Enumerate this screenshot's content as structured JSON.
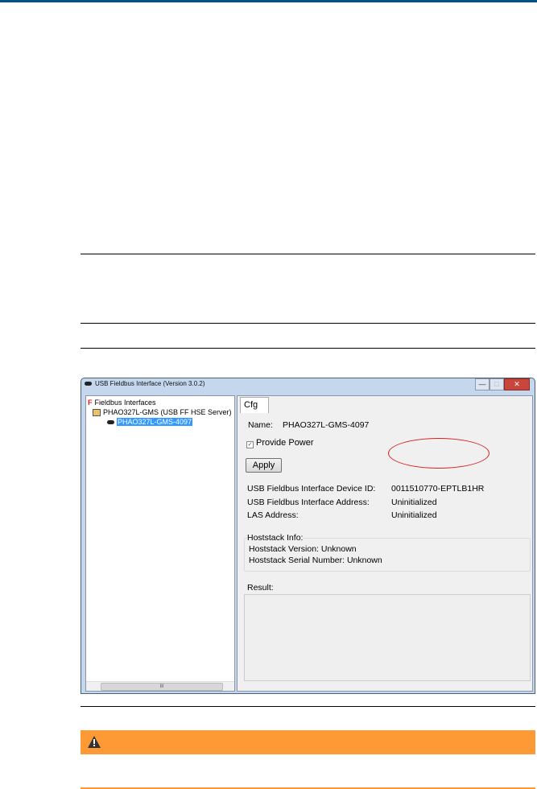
{
  "window": {
    "title": "USB Fieldbus Interface (Version 3.0.2)",
    "minimize": "—",
    "maximize": "□",
    "close": "✕"
  },
  "tree": {
    "root": "Fieldbus Interfaces",
    "server": "PHAO327L-GMS (USB FF HSE Server)",
    "device": "PHAO327L-GMS-4097",
    "scroll_thumb": "III"
  },
  "cfg": {
    "tab": "Cfg",
    "name_label": "Name:",
    "name_value": "PHAO327L-GMS-4097",
    "provide_power": "Provide Power",
    "apply": "Apply",
    "fields": [
      {
        "label": "USB Fieldbus Interface Device ID:",
        "value": "0011510770-EPTLB1HR"
      },
      {
        "label": "USB Fieldbus Interface Address:",
        "value": "Uninitialized"
      },
      {
        "label": "LAS Address:",
        "value": "Uninitialized"
      }
    ],
    "hoststack_title": "Hoststack Info:",
    "hoststack_version": "Hoststack Version:  Unknown",
    "hoststack_serial": "Hoststack Serial Number:  Unknown",
    "result_label": "Result:"
  },
  "colors": {
    "brand": "#00528a",
    "warning": "#fd9a36"
  }
}
